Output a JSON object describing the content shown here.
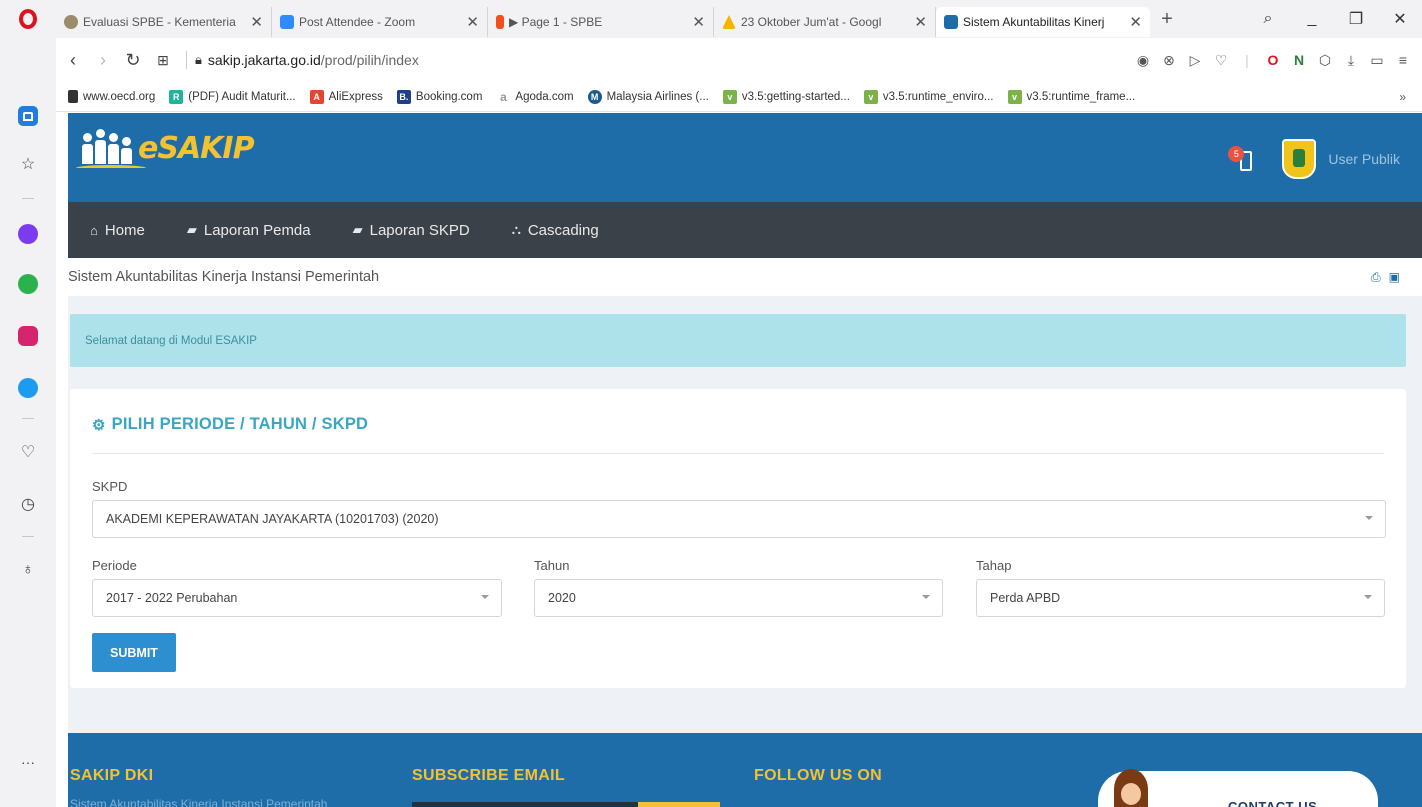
{
  "browser": {
    "tabs": [
      {
        "title": "Evaluasi SPBE - Kementeria",
        "favicon_color": "#9b8c6a",
        "active": false
      },
      {
        "title": "Post Attendee - Zoom",
        "favicon_color": "#2d8cff",
        "active": false
      },
      {
        "title": "▶ Page 1 - SPBE",
        "favicon_color": "#f24e1e",
        "active": false
      },
      {
        "title": "23 Oktober Jum'at - Googl",
        "favicon_color": "#f4b400",
        "active": false
      },
      {
        "title": "Sistem Akuntabilitas Kinerj",
        "favicon_color": "#1f6da8",
        "active": true
      }
    ],
    "new_tab": "+",
    "url_domain": "sakip.jakarta.go.id",
    "url_path": "/prod/pilih/index",
    "bookmarks": [
      {
        "label": "www.oecd.org",
        "color": "#333333",
        "glyph": ""
      },
      {
        "label": "(PDF) Audit Maturit...",
        "color": "#1fb59a",
        "glyph": "R"
      },
      {
        "label": "AliExpress",
        "color": "#e8432e",
        "glyph": "A"
      },
      {
        "label": "Booking.com",
        "color": "#1f3f8c",
        "glyph": "B."
      },
      {
        "label": "Agoda.com",
        "color": "#999999",
        "glyph": "a"
      },
      {
        "label": "Malaysia Airlines (...",
        "color": "#1b5a8c",
        "glyph": "M"
      },
      {
        "label": "v3.5:getting-started...",
        "color": "#7bb34a",
        "glyph": "v"
      },
      {
        "label": "v3.5:runtime_enviro...",
        "color": "#7bb34a",
        "glyph": "v"
      },
      {
        "label": "v3.5:runtime_frame...",
        "color": "#7bb34a",
        "glyph": "v"
      }
    ],
    "bookmarks_more": "»"
  },
  "header": {
    "brand": "eSAKIP",
    "notification_count": "5",
    "user": "User Publik"
  },
  "nav": [
    {
      "icon": "home-icon",
      "glyph": "⌂",
      "label": "Home"
    },
    {
      "icon": "book-icon",
      "glyph": "▰",
      "label": "Laporan Pemda"
    },
    {
      "icon": "book-icon",
      "glyph": "▰",
      "label": "Laporan SKPD"
    },
    {
      "icon": "sitemap-icon",
      "glyph": "⛬",
      "label": "Cascading"
    }
  ],
  "subbar": {
    "title": "Sistem Akuntabilitas Kinerja Instansi Pemerintah"
  },
  "alert": {
    "text": "Selamat datang di Modul ESAKIP"
  },
  "form": {
    "title": "PILIH PERIODE / TAHUN / SKPD",
    "skpd_label": "SKPD",
    "skpd_value": "AKADEMI KEPERAWATAN JAYAKARTA (10201703) (2020)",
    "periode_label": "Periode",
    "periode_value": "2017 - 2022 Perubahan",
    "tahun_label": "Tahun",
    "tahun_value": "2020",
    "tahap_label": "Tahap",
    "tahap_value": "Perda APBD",
    "submit_label": "SUBMIT"
  },
  "footer": {
    "col1_title": "SAKIP DKI",
    "col1_text": "Sistem Akuntabilitas Kinerja Instansi Pemerintah",
    "col2_title": "SUBSCRIBE EMAIL",
    "col3_title": "FOLLOW US ON",
    "contact_label": "CONTACT US"
  },
  "colors": {
    "header_blue": "#1f6da8",
    "nav_dark": "#3b4148",
    "accent_yellow": "#f2c230",
    "title_teal": "#3aa6c2",
    "submit_blue": "#2d8fd0",
    "alert_bg": "#aee2ea"
  }
}
